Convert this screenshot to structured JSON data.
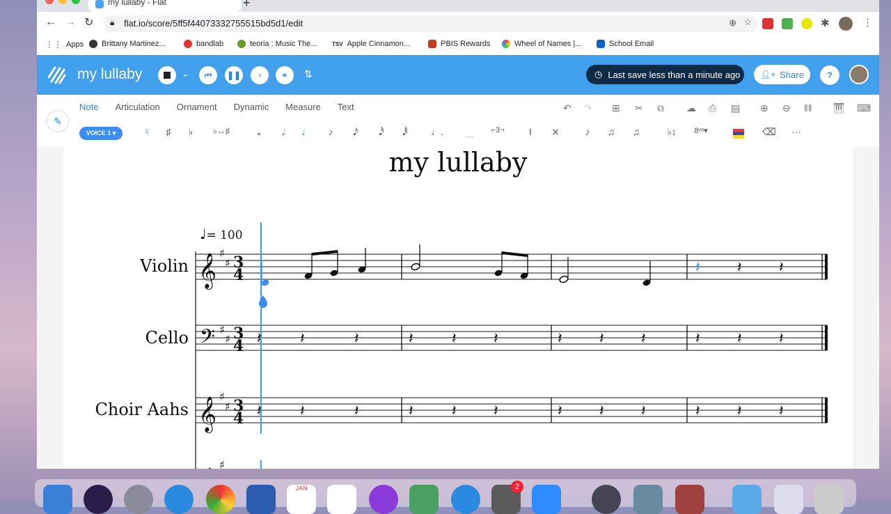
{
  "browser": {
    "tab_title": "my lullaby - Flat",
    "new_tab": "+",
    "url": "flat.io/score/5ff5f44073332755515bd5d1/edit",
    "bookmarks": [
      {
        "label": "Apps",
        "color": "#777777"
      },
      {
        "label": "Brittany Martinez...",
        "color": "#333333"
      },
      {
        "label": "bandlab",
        "color": "#e0322e"
      },
      {
        "label": "teoria : Music The...",
        "color": "#6a9a2a"
      },
      {
        "label": "Apple Cinnamon...",
        "color": "#222222"
      },
      {
        "label": "PBIS Rewards",
        "color": "#c43c1c"
      },
      {
        "label": "Wheel of Names |...",
        "color": "#3a6fd8"
      },
      {
        "label": "School Email",
        "color": "#0a64c8"
      }
    ],
    "bookmark_prefix_tsv": "TSV"
  },
  "app": {
    "name": "my lullaby",
    "save_status": "Last save less than a minute ago",
    "share_label": "Share",
    "help": "?",
    "brand_color": "#41a0ec"
  },
  "toolbar": {
    "tabs": [
      "Note",
      "Articulation",
      "Ornament",
      "Dynamic",
      "Measure",
      "Text"
    ],
    "active_tab": "Note",
    "voice_label": "VOICE 1 ▾",
    "more": "···"
  },
  "score": {
    "title": "my lullaby",
    "tempo_value": "= 100",
    "time_signature_top": "3",
    "time_signature_bottom": "4",
    "instruments": [
      "Violin",
      "Cello",
      "Choir Aahs"
    ]
  },
  "dock": {
    "badges": [
      "2"
    ],
    "calendar_month": "JAN"
  }
}
